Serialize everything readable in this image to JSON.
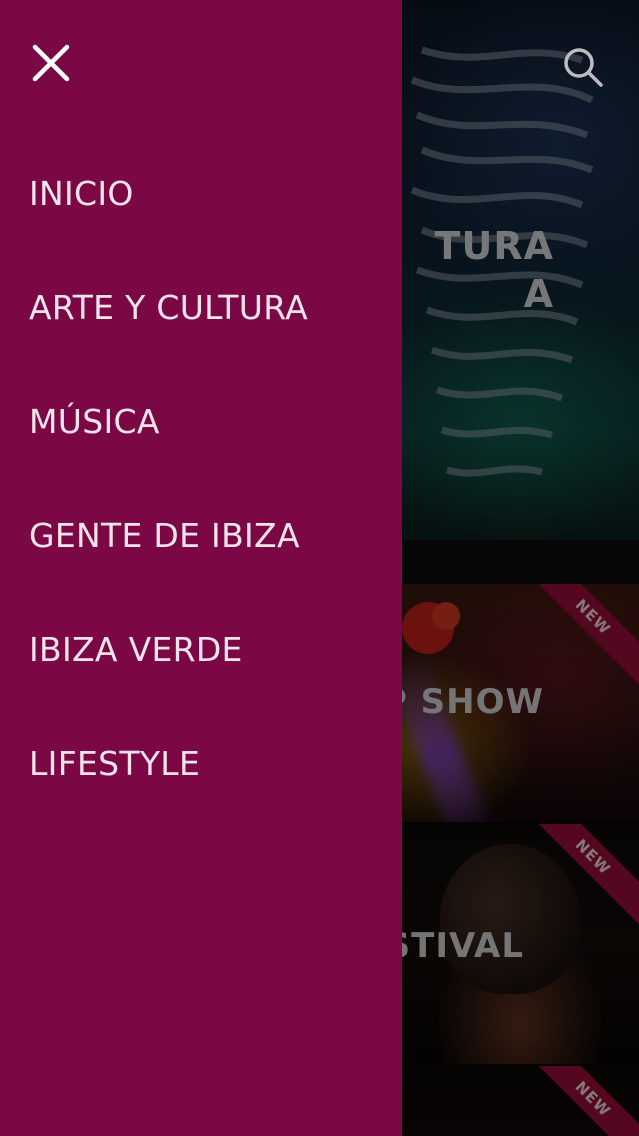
{
  "header": {
    "close_icon": "close-icon",
    "search_icon": "search-icon"
  },
  "menu": {
    "items": [
      {
        "label": "INICIO"
      },
      {
        "label": "ARTE Y CULTURA"
      },
      {
        "label": "MÚSICA"
      },
      {
        "label": "GENTE DE IBIZA"
      },
      {
        "label": "IBIZA VERDE"
      },
      {
        "label": "LIFESTYLE"
      }
    ]
  },
  "background": {
    "hero": {
      "title_partial": "TURA\nA"
    },
    "cards": [
      {
        "title_partial": "P SHOW",
        "badge": "NEW"
      },
      {
        "title_partial": "STIVAL",
        "badge": "NEW"
      },
      {
        "badge": "NEW"
      }
    ]
  },
  "colors": {
    "drawer_bg": "#7b0845",
    "menu_text": "#f3e4ec",
    "badge_bg": "#9a0d3a"
  }
}
